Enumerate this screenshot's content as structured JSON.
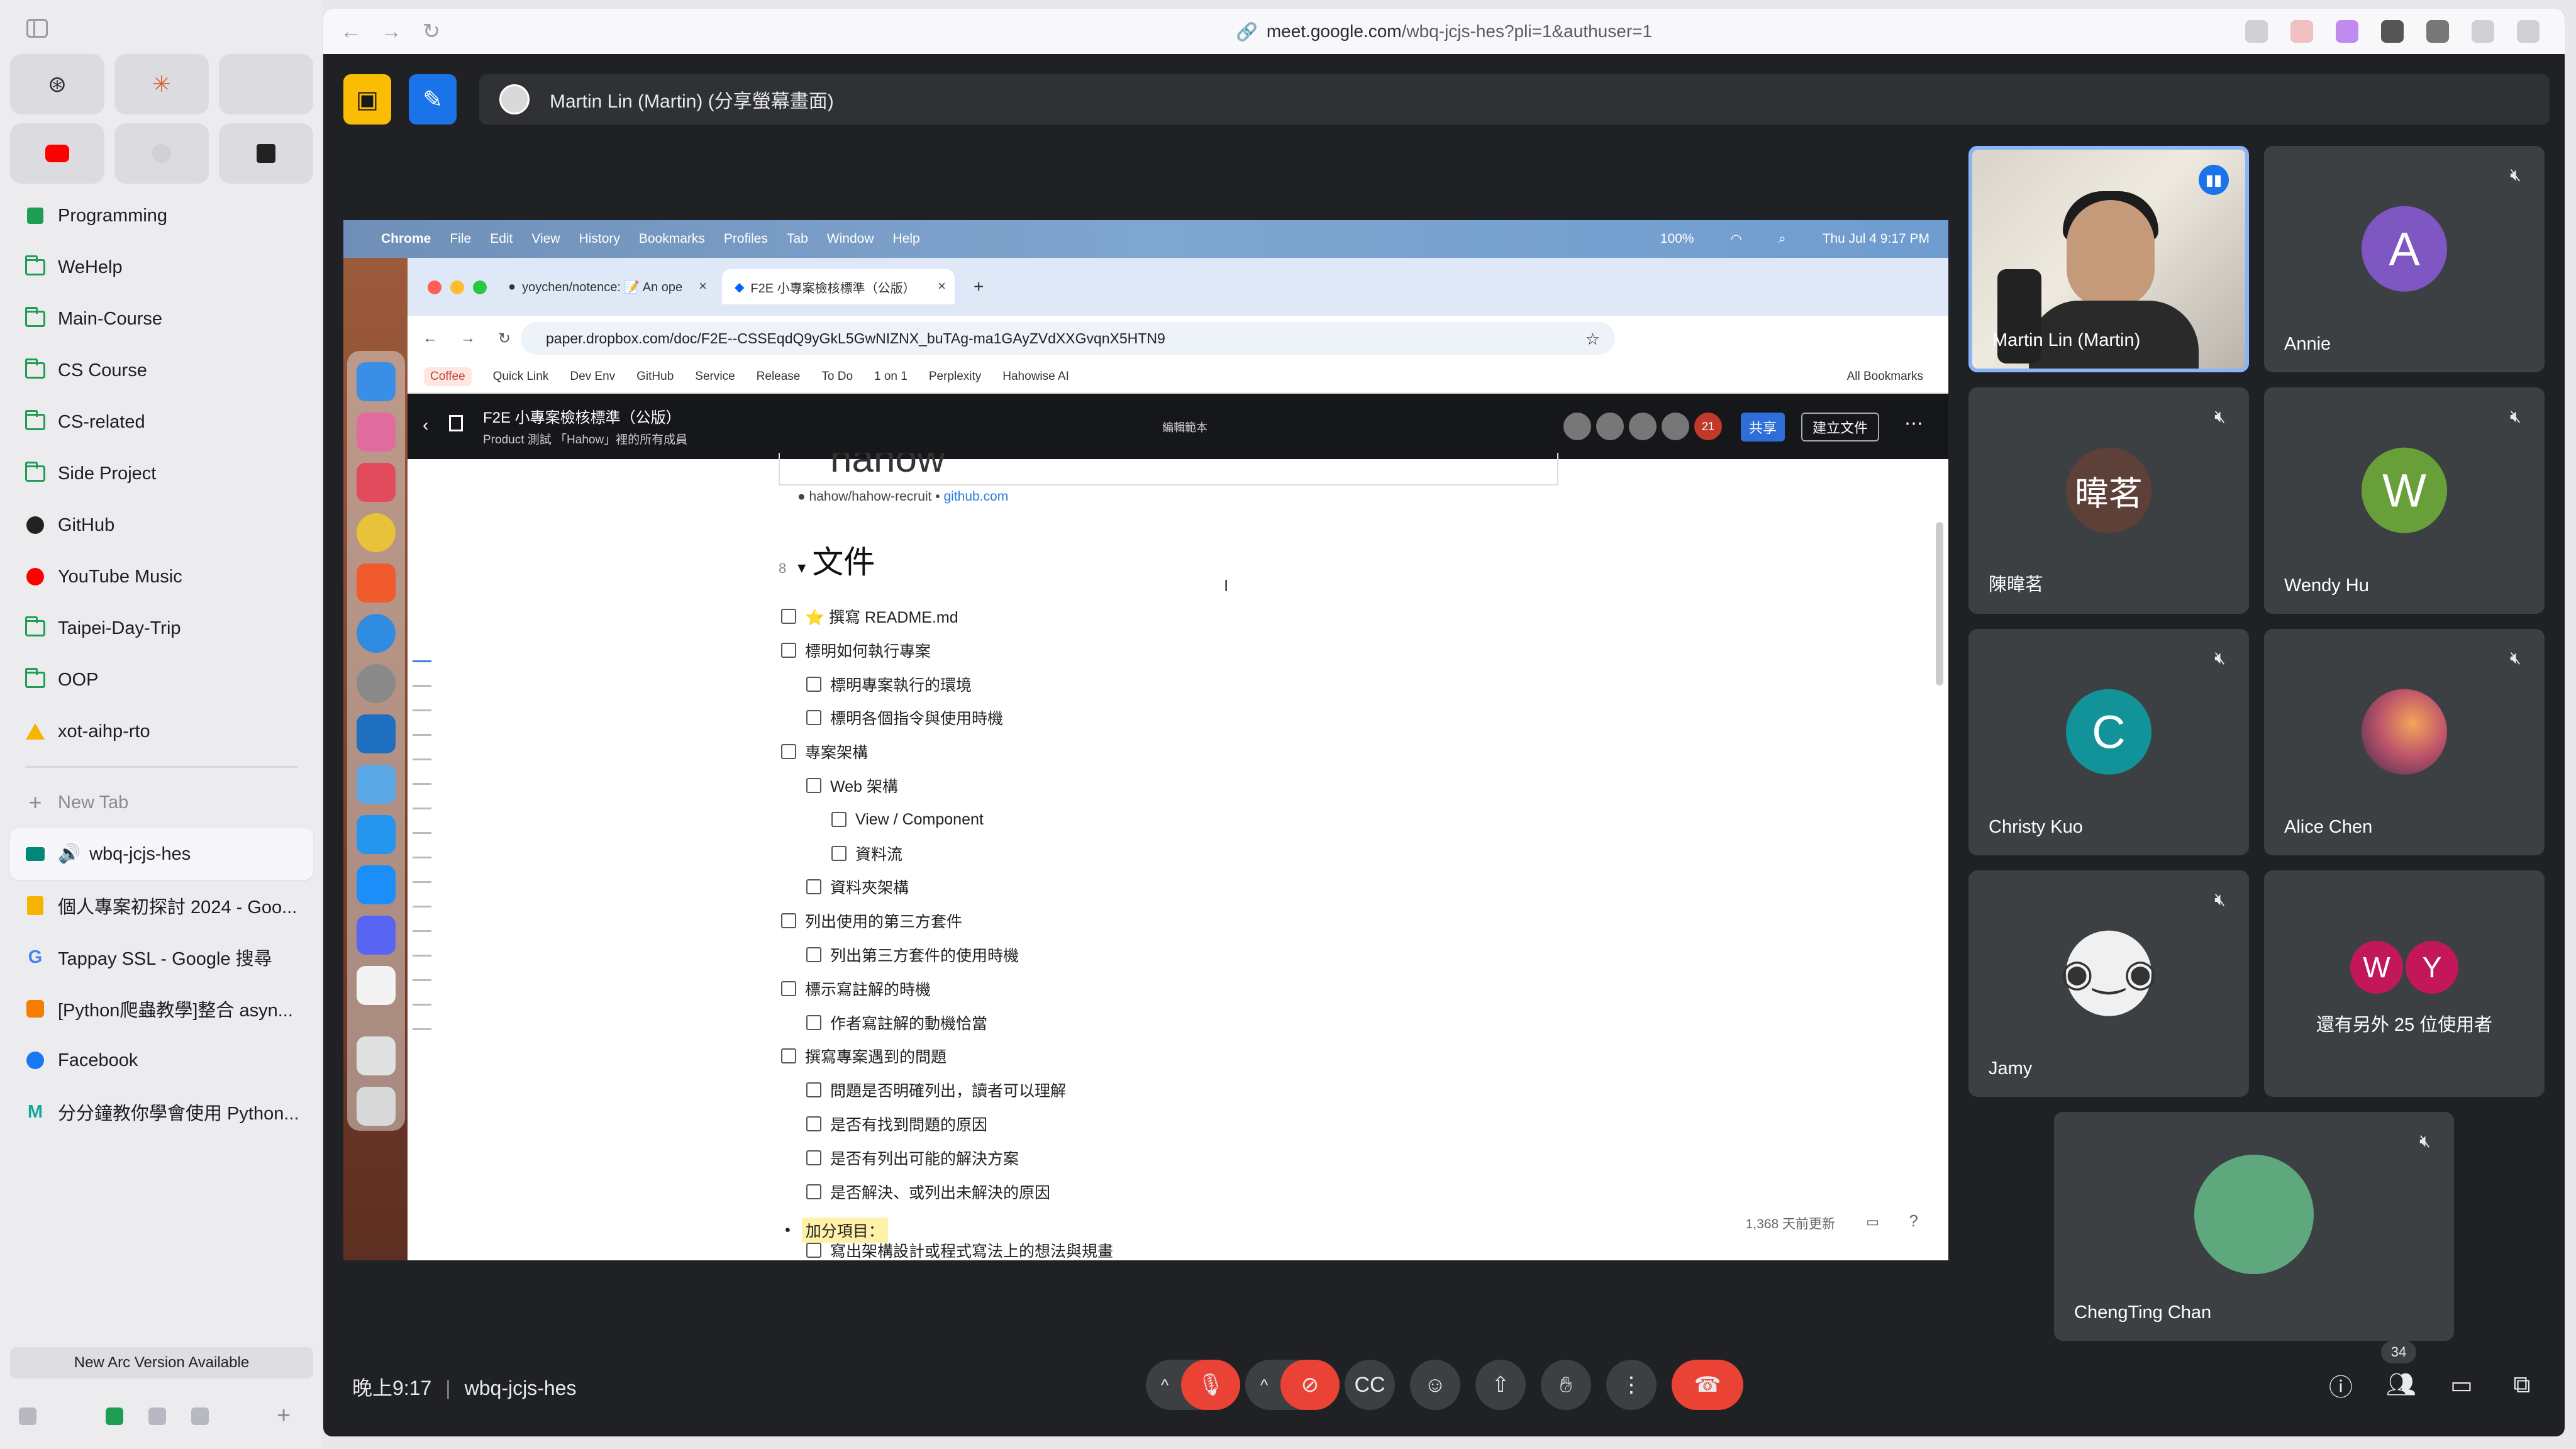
{
  "browser": {
    "url_domain": "meet.google.com",
    "url_path": "/wbq-jcjs-hes?pli=1&authuser=1"
  },
  "sidebar": {
    "folders": [
      {
        "label": "Programming",
        "icon": "grid-icon"
      },
      {
        "label": "WeHelp",
        "icon": "folder-icon"
      },
      {
        "label": "Main-Course",
        "icon": "folder-icon"
      },
      {
        "label": "CS Course",
        "icon": "folder-icon"
      },
      {
        "label": "CS-related",
        "icon": "folder-icon"
      },
      {
        "label": "Side Project",
        "icon": "folder-icon"
      },
      {
        "label": "GitHub",
        "icon": "github-icon"
      },
      {
        "label": "YouTube Music",
        "icon": "youtube-music-icon"
      },
      {
        "label": "Taipei-Day-Trip",
        "icon": "folder-icon"
      },
      {
        "label": "OOP",
        "icon": "folder-icon"
      },
      {
        "label": "xot-aihp-rto",
        "icon": "google-drive-icon"
      }
    ],
    "new_tab": "New Tab",
    "tabs": [
      {
        "label": "wbq-jcjs-hes",
        "icon": "google-meet-icon",
        "active": true
      },
      {
        "label": "個人專案初探討 2024 - Goo...",
        "icon": "google-slides-icon"
      },
      {
        "label": "Tappay SSL - Google 搜尋",
        "icon": "google-icon"
      },
      {
        "label": "[Python爬蟲教學]整合 asyn...",
        "icon": "blogger-icon"
      },
      {
        "label": "Facebook",
        "icon": "facebook-icon"
      },
      {
        "label": "分分鐘教你學會使用 Python...",
        "icon": "medium-icon"
      }
    ],
    "update_notice": "New Arc Version Available"
  },
  "meet": {
    "presenter_label": "Martin Lin (Martin) (分享螢幕畫面)",
    "time": "晚上9:17",
    "meeting_code": "wbq-jcjs-hes",
    "participant_count": "34",
    "participants": [
      {
        "name": "Martin Lin (Martin)",
        "type": "video",
        "speaking": true
      },
      {
        "name": "Annie",
        "initial": "A",
        "color": "#7e57c2"
      },
      {
        "name": "陳暐茗",
        "initial": "暐茗",
        "color": "#5d4037"
      },
      {
        "name": "Wendy Hu",
        "initial": "W",
        "color": "#689f38"
      },
      {
        "name": "Christy Kuo",
        "initial": "C",
        "color": "#12939a"
      },
      {
        "name": "Alice Chen",
        "initial": "",
        "color": "#c0566a"
      },
      {
        "name": "Jamy",
        "initial": "",
        "color": "#f0f0f0"
      },
      {
        "name": "ChengTing Chan",
        "initial": "",
        "color": "#5fa77c"
      }
    ],
    "others": {
      "label": "還有另外 25 位使用者",
      "initials": [
        "W",
        "Y"
      ],
      "colors": [
        "#c2185b",
        "#c2185b"
      ]
    }
  },
  "shared_screen": {
    "mac_menu": [
      "Chrome",
      "File",
      "Edit",
      "View",
      "History",
      "Bookmarks",
      "Profiles",
      "Tab",
      "Window",
      "Help"
    ],
    "mac_status": {
      "battery": "100%",
      "datetime": "Thu Jul 4  9:17 PM"
    },
    "chrome_tabs": [
      {
        "label": "yoychen/notence: 📝 An ope"
      },
      {
        "label": "F2E 小專案檢核標準（公版）"
      }
    ],
    "address": "paper.dropbox.com/doc/F2E--CSSEqdQ9yGkL5GwNIZNX_buTAg-ma1GAyZVdXXGvqnX5HTN9",
    "bookmarks": [
      "Coffee",
      "Quick Link",
      "Dev Env",
      "GitHub",
      "Service",
      "Release",
      "To Do",
      "1 on 1",
      "Perplexity",
      "Hahowise AI"
    ],
    "all_bookmarks": "All Bookmarks",
    "doc": {
      "title": "F2E 小專案檢核標準（公版）",
      "breadcrumb": "Product   測試        「Hahow」裡的所有成員",
      "mode": "編輯範本",
      "avatar_count": "21",
      "share": "共享",
      "create": "建立文件",
      "code_card": "hahow",
      "link_text": "hahow/hahow-recruit",
      "link_domain": "github.com",
      "heading_marker": "8",
      "heading": "文件",
      "tasks": [
        {
          "text": "⭐ 撰寫 README.md",
          "level": 0
        },
        {
          "text": "標明如何執行專案",
          "level": 0
        },
        {
          "text": "標明專案執行的環境",
          "level": 1
        },
        {
          "text": "標明各個指令與使用時機",
          "level": 1
        },
        {
          "text": "專案架構",
          "level": 0
        },
        {
          "text": "Web 架構",
          "level": 1
        },
        {
          "text": "View / Component",
          "level": 2
        },
        {
          "text": "資料流",
          "level": 2
        },
        {
          "text": "資料夾架構",
          "level": 1
        },
        {
          "text": "列出使用的第三方套件",
          "level": 0
        },
        {
          "text": "列出第三方套件的使用時機",
          "level": 1
        },
        {
          "text": "標示寫註解的時機",
          "level": 0
        },
        {
          "text": "作者寫註解的動機恰當",
          "level": 1
        },
        {
          "text": "撰寫專案遇到的問題",
          "level": 0
        },
        {
          "text": "問題是否明確列出，讀者可以理解",
          "level": 1
        },
        {
          "text": "是否有找到問題的原因",
          "level": 1
        },
        {
          "text": "是否有列出可能的解決方案",
          "level": 1
        },
        {
          "text": "是否解決、或列出未解決的原因",
          "level": 1
        }
      ],
      "bonus_label": "加分項目：",
      "bonus_task": "寫出架構設計或程式寫法上的想法與規畫",
      "updated": "1,368 天前更新"
    }
  }
}
